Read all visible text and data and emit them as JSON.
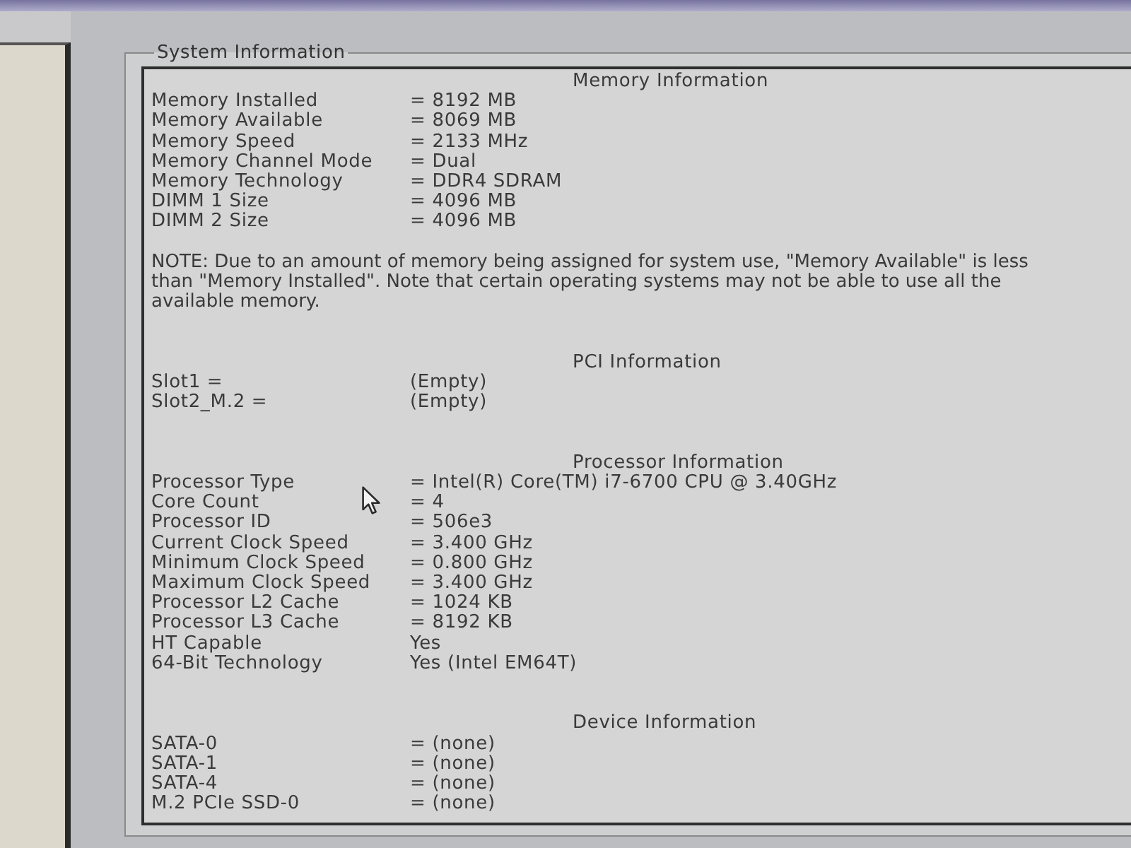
{
  "group_title": "System Information",
  "sections": [
    {
      "heading": "Memory Information",
      "rows": [
        {
          "label": "Memory Installed",
          "value": "= 8192 MB"
        },
        {
          "label": "Memory Available",
          "value": "= 8069 MB"
        },
        {
          "label": "Memory Speed",
          "value": "= 2133 MHz"
        },
        {
          "label": "Memory Channel Mode",
          "value": "= Dual"
        },
        {
          "label": "Memory Technology",
          "value": "= DDR4 SDRAM"
        },
        {
          "label": "DIMM 1 Size",
          "value": "= 4096 MB"
        },
        {
          "label": "DIMM 2 Size",
          "value": "= 4096 MB"
        }
      ],
      "note": "NOTE: Due to an amount of memory being assigned for system use, \"Memory Available\" is less than \"Memory Installed\". Note that certain operating systems may not be able to use all the available memory."
    },
    {
      "heading": "PCI Information",
      "rows": [
        {
          "label": "Slot1 =",
          "value": "(Empty)"
        },
        {
          "label": "Slot2_M.2 =",
          "value": "(Empty)"
        }
      ]
    },
    {
      "heading": "Processor Information",
      "rows": [
        {
          "label": "Processor Type",
          "value": "= Intel(R) Core(TM) i7-6700 CPU @ 3.40GHz"
        },
        {
          "label": "Core Count",
          "value": "= 4"
        },
        {
          "label": "Processor ID",
          "value": "= 506e3"
        },
        {
          "label": "Current Clock Speed",
          "value": "= 3.400 GHz"
        },
        {
          "label": "Minimum Clock Speed",
          "value": "= 0.800 GHz"
        },
        {
          "label": "Maximum Clock Speed",
          "value": "= 3.400 GHz"
        },
        {
          "label": "Processor L2 Cache",
          "value": "= 1024 KB"
        },
        {
          "label": "Processor L3 Cache",
          "value": "= 8192 KB"
        },
        {
          "label": "HT Capable",
          "value": "Yes"
        },
        {
          "label": "64-Bit Technology",
          "value": "Yes (Intel EM64T)"
        }
      ]
    },
    {
      "heading": "Device Information",
      "rows": [
        {
          "label": "SATA-0",
          "value": "= (none)"
        },
        {
          "label": "SATA-1",
          "value": "= (none)"
        },
        {
          "label": "SATA-4",
          "value": "= (none)"
        },
        {
          "label": "M.2 PCIe SSD-0",
          "value": "= (none)"
        }
      ]
    }
  ]
}
